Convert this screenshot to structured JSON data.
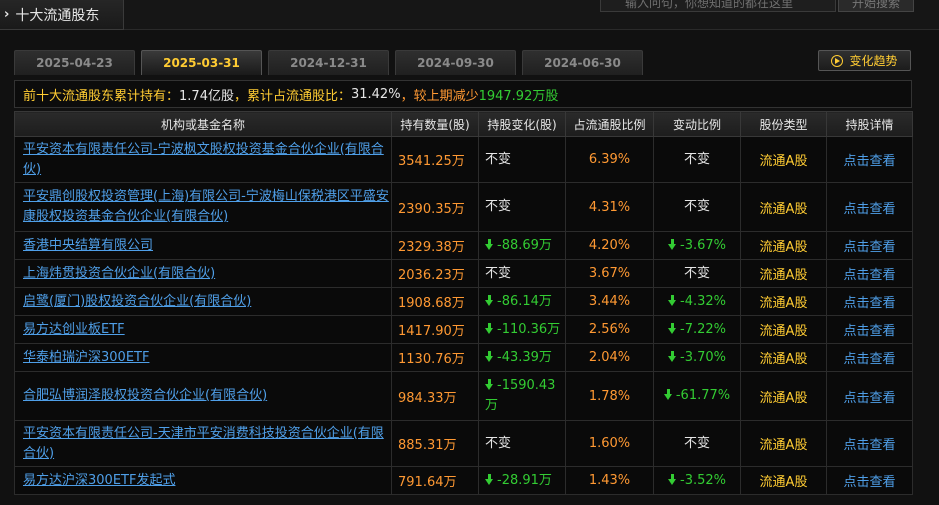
{
  "section": {
    "title": "十大流通股东"
  },
  "search": {
    "placeholder": "输入问句，你想知道的都在这里",
    "button": "开始搜索"
  },
  "tabs": [
    {
      "label": "2025-04-23",
      "active": false
    },
    {
      "label": "2025-03-31",
      "active": true
    },
    {
      "label": "2024-12-31",
      "active": false
    },
    {
      "label": "2024-09-30",
      "active": false
    },
    {
      "label": "2024-06-30",
      "active": false
    }
  ],
  "trend_button": "变化趋势",
  "summary": {
    "part1": "前十大流通股东累计持有：",
    "hold": "1.74亿股",
    "part2": "，累计占流通股比：",
    "ratio": "31.42%",
    "part3": "，较上期减少",
    "decrease": "1947.92万股"
  },
  "columns": [
    "机构或基金名称",
    "持有数量(股)",
    "持股变化(股)",
    "占流通股比例",
    "变动比例",
    "股份类型",
    "持股详情"
  ],
  "rows": [
    {
      "name": "平安资本有限责任公司-宁波枫文股权投资基金合伙企业(有限合伙)",
      "amount": "3541.25万",
      "change": "不变",
      "change_dir": "none",
      "ratio": "6.39%",
      "change_ratio": "不变",
      "type": "流通A股",
      "detail": "点击查看"
    },
    {
      "name": "平安鼎创股权投资管理(上海)有限公司-宁波梅山保税港区平盛安康股权投资基金合伙企业(有限合伙)",
      "amount": "2390.35万",
      "change": "不变",
      "change_dir": "none",
      "ratio": "4.31%",
      "change_ratio": "不变",
      "type": "流通A股",
      "detail": "点击查看"
    },
    {
      "name": "香港中央结算有限公司",
      "amount": "2329.38万",
      "change": "-88.69万",
      "change_dir": "down",
      "ratio": "4.20%",
      "change_ratio": "-3.67%",
      "type": "流通A股",
      "detail": "点击查看"
    },
    {
      "name": "上海炜贯投资合伙企业(有限合伙)",
      "amount": "2036.23万",
      "change": "不变",
      "change_dir": "none",
      "ratio": "3.67%",
      "change_ratio": "不变",
      "type": "流通A股",
      "detail": "点击查看"
    },
    {
      "name": "启鹭(厦门)股权投资合伙企业(有限合伙)",
      "amount": "1908.68万",
      "change": "-86.14万",
      "change_dir": "down",
      "ratio": "3.44%",
      "change_ratio": "-4.32%",
      "type": "流通A股",
      "detail": "点击查看"
    },
    {
      "name": "易方达创业板ETF",
      "amount": "1417.90万",
      "change": "-110.36万",
      "change_dir": "down",
      "ratio": "2.56%",
      "change_ratio": "-7.22%",
      "type": "流通A股",
      "detail": "点击查看"
    },
    {
      "name": "华泰柏瑞沪深300ETF",
      "amount": "1130.76万",
      "change": "-43.39万",
      "change_dir": "down",
      "ratio": "2.04%",
      "change_ratio": "-3.70%",
      "type": "流通A股",
      "detail": "点击查看"
    },
    {
      "name": "合肥弘博润泽股权投资合伙企业(有限合伙)",
      "amount": "984.33万",
      "change": "-1590.43万",
      "change_dir": "down",
      "ratio": "1.78%",
      "change_ratio": "-61.77%",
      "type": "流通A股",
      "detail": "点击查看"
    },
    {
      "name": "平安资本有限责任公司-天津市平安消费科技投资合伙企业(有限合伙)",
      "amount": "885.31万",
      "change": "不变",
      "change_dir": "none",
      "ratio": "1.60%",
      "change_ratio": "不变",
      "type": "流通A股",
      "detail": "点击查看"
    },
    {
      "name": "易方达沪深300ETF发起式",
      "amount": "791.64万",
      "change": "-28.91万",
      "change_dir": "down",
      "ratio": "1.43%",
      "change_ratio": "-3.52%",
      "type": "流通A股",
      "detail": "点击查看"
    }
  ],
  "colors": {
    "accent": "#ffcc33",
    "link": "#4f9fe8",
    "value": "#ff9933",
    "down": "#33cc33"
  }
}
